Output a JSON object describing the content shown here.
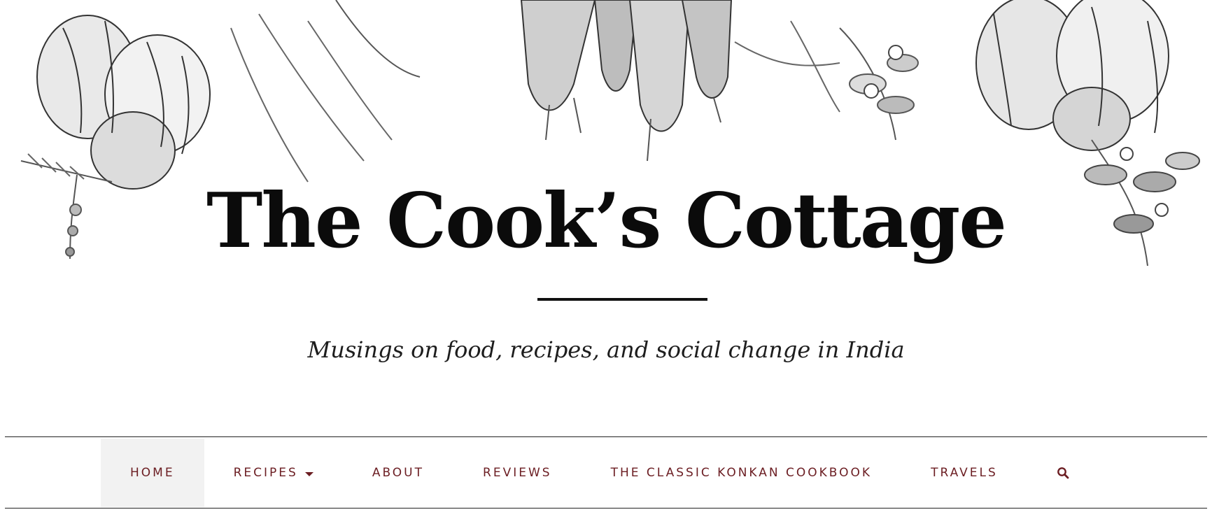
{
  "header": {
    "site_title": "The Cook’s Cottage",
    "tagline": "Musings on food, recipes, and social change in India",
    "banner_art": "engraved-vegetables-illustration"
  },
  "nav": {
    "items": [
      {
        "label": "HOME",
        "active": true
      },
      {
        "label": "RECIPES",
        "has_dropdown": true
      },
      {
        "label": "ABOUT"
      },
      {
        "label": "REVIEWS"
      },
      {
        "label": "THE CLASSIC KONKAN COOKBOOK"
      },
      {
        "label": "TRAVELS"
      }
    ],
    "search_icon": "search-icon"
  },
  "colors": {
    "nav_text": "#6b1d22",
    "active_bg": "#f2f2f2",
    "title": "#0b0b0b"
  }
}
